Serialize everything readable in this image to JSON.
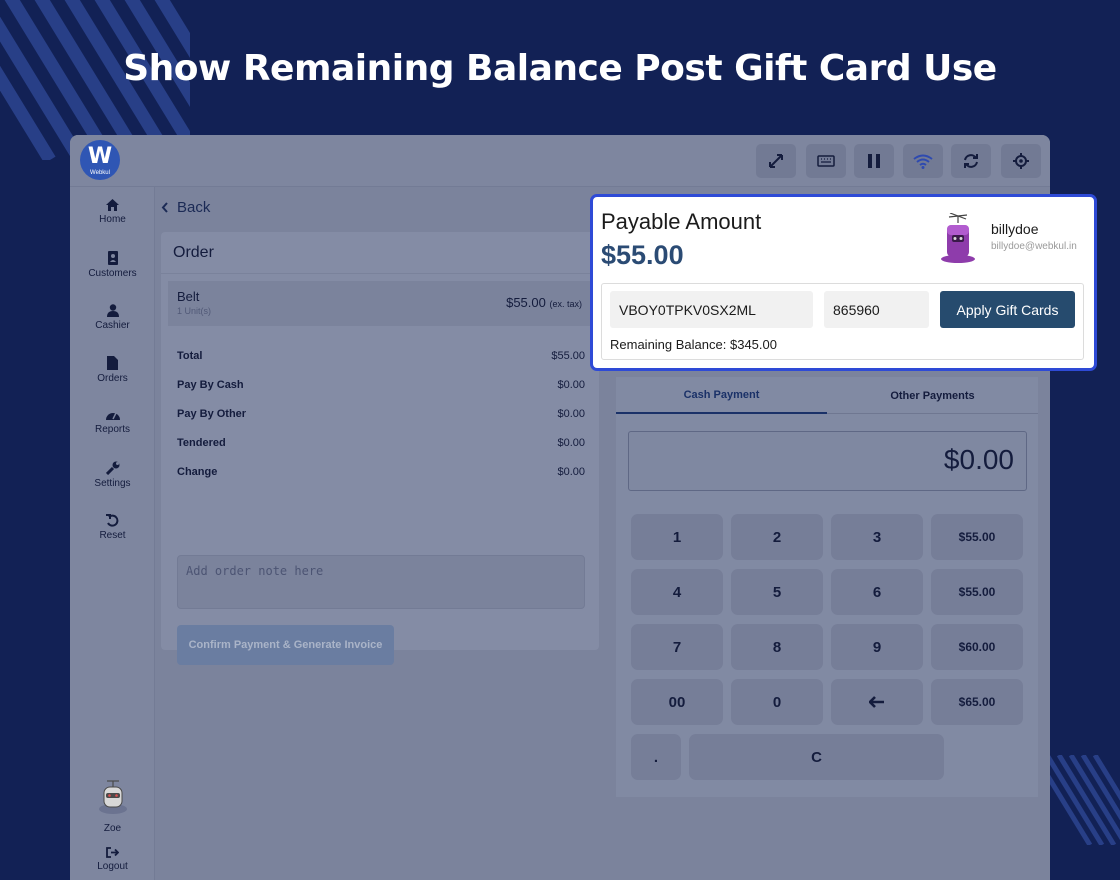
{
  "headline": "Show Remaining Balance Post Gift Card Use",
  "colors": {
    "background": "#122155",
    "accent": "#2e4ad6",
    "primary_button": "#264b6e",
    "amount": "#2b4b74"
  },
  "app": {
    "logo_text": "Webkul",
    "toolbar_icons": [
      "fullscreen-icon",
      "keyboard-icon",
      "pause-icon",
      "wifi-icon",
      "refresh-icon",
      "settings-gear-icon"
    ]
  },
  "sidebar": {
    "items": [
      {
        "label": "Home",
        "icon": "home-icon"
      },
      {
        "label": "Customers",
        "icon": "address-book-icon"
      },
      {
        "label": "Cashier",
        "icon": "user-icon"
      },
      {
        "label": "Orders",
        "icon": "file-icon"
      },
      {
        "label": "Reports",
        "icon": "dashboard-icon"
      },
      {
        "label": "Settings",
        "icon": "wrench-icon"
      },
      {
        "label": "Reset",
        "icon": "undo-icon"
      }
    ],
    "user": {
      "name": "Zoe"
    },
    "logout_label": "Logout"
  },
  "main": {
    "back_label": "Back",
    "order": {
      "title": "Order",
      "item": {
        "name": "Belt",
        "units": "1 Unit(s)",
        "price": "$55.00",
        "tax_note": "(ex. tax)"
      },
      "summary": [
        {
          "label": "Total",
          "value": "$55.00"
        },
        {
          "label": "Pay By Cash",
          "value": "$0.00"
        },
        {
          "label": "Pay By Other",
          "value": "$0.00"
        },
        {
          "label": "Tendered",
          "value": "$0.00"
        },
        {
          "label": "Change",
          "value": "$0.00"
        }
      ],
      "note_placeholder": "Add order note here",
      "confirm_label": "Confirm Payment & Generate Invoice"
    },
    "payment": {
      "tabs": [
        "Cash Payment",
        "Other Payments"
      ],
      "active_tab": "Cash Payment",
      "amount": "$0.00",
      "keys": [
        [
          "1",
          "2",
          "3",
          "$55.00"
        ],
        [
          "4",
          "5",
          "6",
          "$55.00"
        ],
        [
          "7",
          "8",
          "9",
          "$60.00"
        ],
        [
          "00",
          "0",
          "backspace",
          "$65.00"
        ]
      ],
      "dot_key": ".",
      "clear_key": "C"
    }
  },
  "popup": {
    "title": "Payable Amount",
    "amount": "$55.00",
    "customer": {
      "name": "billydoe",
      "email": "billydoe@webkul.in"
    },
    "gift_card_code": "VBOY0TPKV0SX2ML",
    "gift_card_pin": "865960",
    "apply_label": "Apply Gift Cards",
    "remaining_label": "Remaining Balance:",
    "remaining_value": "$345.00"
  }
}
